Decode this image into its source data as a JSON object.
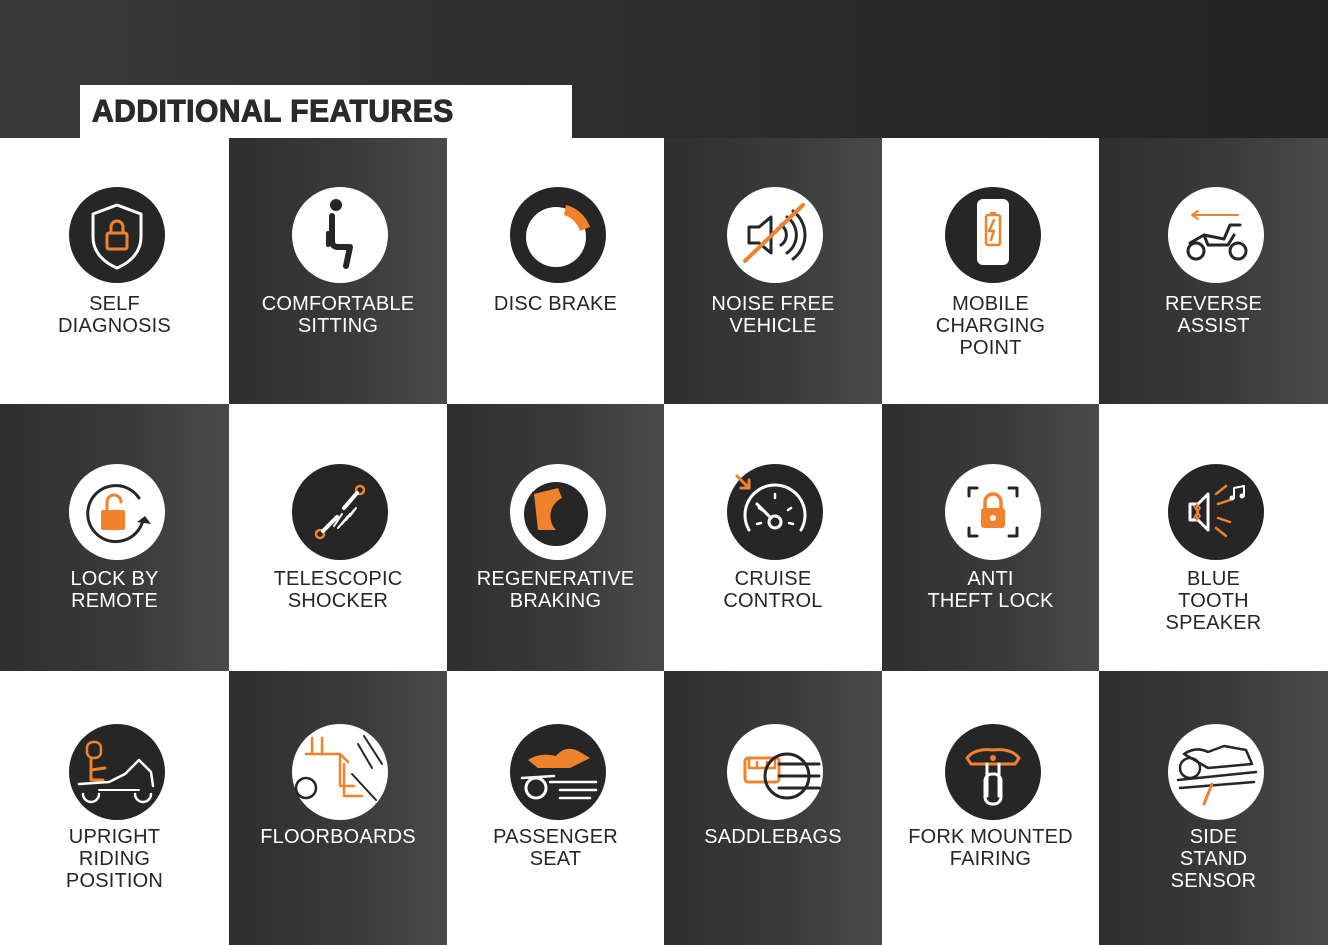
{
  "title": "ADDITIONAL FEATURES",
  "colors": {
    "accent": "#f0822d",
    "dark": "#262626",
    "light": "#ffffff"
  },
  "features": [
    {
      "label": "SELF\nDIAGNOSIS",
      "icon": "shield-lock-icon"
    },
    {
      "label": "COMFORTABLE\nSITTING",
      "icon": "seated-person-icon"
    },
    {
      "label": "DISC BRAKE",
      "icon": "disc-brake-icon"
    },
    {
      "label": "NOISE FREE\nVEHICLE",
      "icon": "muted-speaker-icon"
    },
    {
      "label": "MOBILE\nCHARGING\nPOINT",
      "icon": "phone-charging-icon"
    },
    {
      "label": "REVERSE\nASSIST",
      "icon": "scooter-reverse-icon"
    },
    {
      "label": "LOCK BY\nREMOTE",
      "icon": "remote-lock-icon"
    },
    {
      "label": "TELESCOPIC\nSHOCKER",
      "icon": "shock-absorber-icon"
    },
    {
      "label": "REGENERATIVE\nBRAKING",
      "icon": "regenerative-brake-icon"
    },
    {
      "label": "CRUISE\nCONTROL",
      "icon": "speedometer-icon"
    },
    {
      "label": "ANTI\nTHEFT LOCK",
      "icon": "padlock-frame-icon"
    },
    {
      "label": "BLUE\nTOOTH\nSPEAKER",
      "icon": "bluetooth-speaker-icon"
    },
    {
      "label": "UPRIGHT\nRIDING\nPOSITION",
      "icon": "upright-rider-icon"
    },
    {
      "label": "FLOORBOARDS",
      "icon": "floorboard-icon"
    },
    {
      "label": "PASSENGER\nSEAT",
      "icon": "passenger-seat-icon"
    },
    {
      "label": "SADDLEBAGS",
      "icon": "saddlebag-icon"
    },
    {
      "label": "FORK MOUNTED\nFAIRING",
      "icon": "fork-fairing-icon"
    },
    {
      "label": "SIDE\nSTAND\nSENSOR",
      "icon": "side-stand-icon"
    }
  ]
}
